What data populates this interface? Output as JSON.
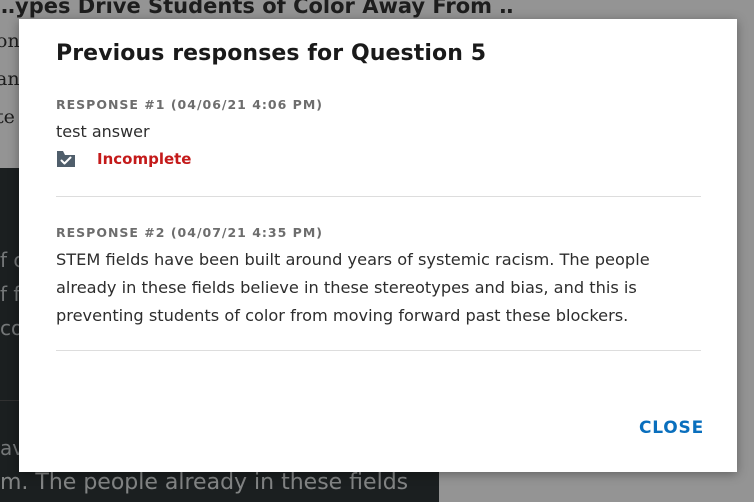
{
  "background": {
    "article_title": "…ypes Drive Students of Color Away From …",
    "side_text_lines": [
      "on",
      "an",
      "te"
    ],
    "dark_panel_fragments": [
      "f c",
      "f fa",
      "co"
    ],
    "dark_panel_fragment_bottom": "av",
    "bottom_text": "m. The people already in these fields"
  },
  "modal": {
    "title": "Previous responses for Question 5",
    "close_label": "CLOSE",
    "responses": [
      {
        "header": "RESPONSE #1 (04/06/21 4:06 PM)",
        "body": "test answer",
        "status_label": "Incomplete",
        "status_icon": "submitted-checkmark-icon"
      },
      {
        "header": "RESPONSE #2 (04/07/21 4:35 PM)",
        "body": "STEM fields have been built around years of systemic racism. The people already in these fields believe in these stereotypes and bias, and this is preventing students of color from moving forward past these blockers."
      }
    ]
  },
  "colors": {
    "status_incomplete": "#c41a1a",
    "close_link": "#0a6fbd",
    "overlay": "rgba(0,0,0,0.42)"
  }
}
